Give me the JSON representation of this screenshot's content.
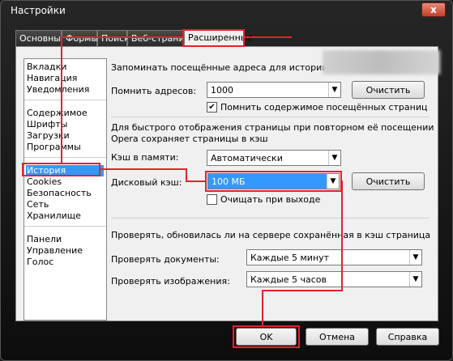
{
  "window": {
    "title": "Настройки",
    "close_symbol": "x"
  },
  "tabs": [
    "Основные",
    "Формы",
    "Поиск",
    "Веб-страницы",
    "Расширенные"
  ],
  "nav": {
    "group1": [
      "Вкладки",
      "Навигация",
      "Уведомления"
    ],
    "group2": [
      "Содержимое",
      "Шрифты",
      "Загрузки",
      "Программы"
    ],
    "group3": [
      "История",
      "Cookies",
      "Безопасность",
      "Сеть",
      "Хранилище"
    ],
    "group4": [
      "Панели",
      "Управление",
      "Голос"
    ],
    "selected": "История"
  },
  "history": {
    "remember_heading": "Запоминать посещённые адреса для истории и автоза",
    "remember_label": "Помнить адресов:",
    "remember_value": "1000",
    "clear_label": "Очистить",
    "remember_content_checked": true,
    "remember_content_label": "Помнить содержимое посещённых страниц"
  },
  "cache": {
    "heading_line1": "Для быстрого отображения страницы при повторном её посещении",
    "heading_line2": "Opera сохраняет страницы в кэш",
    "memory_label": "Кэш в памяти:",
    "memory_value": "Автоматически",
    "disk_label": "Дисковый кэш:",
    "disk_value": "100 МБ",
    "clear_label": "Очистить",
    "clear_on_exit_checked": false,
    "clear_on_exit_label": "Очищать при выходе"
  },
  "check": {
    "heading": "Проверять, обновилась ли на сервере сохранённая в кэш страница",
    "docs_label": "Проверять документы:",
    "docs_value": "Каждые 5 минут",
    "images_label": "Проверять изображения:",
    "images_value": "Каждые 5 часов"
  },
  "footer": {
    "ok": "OK",
    "cancel": "Отмена",
    "help": "Справка"
  },
  "colors": {
    "highlight": "#e8202a",
    "selection": "#3399ff"
  }
}
